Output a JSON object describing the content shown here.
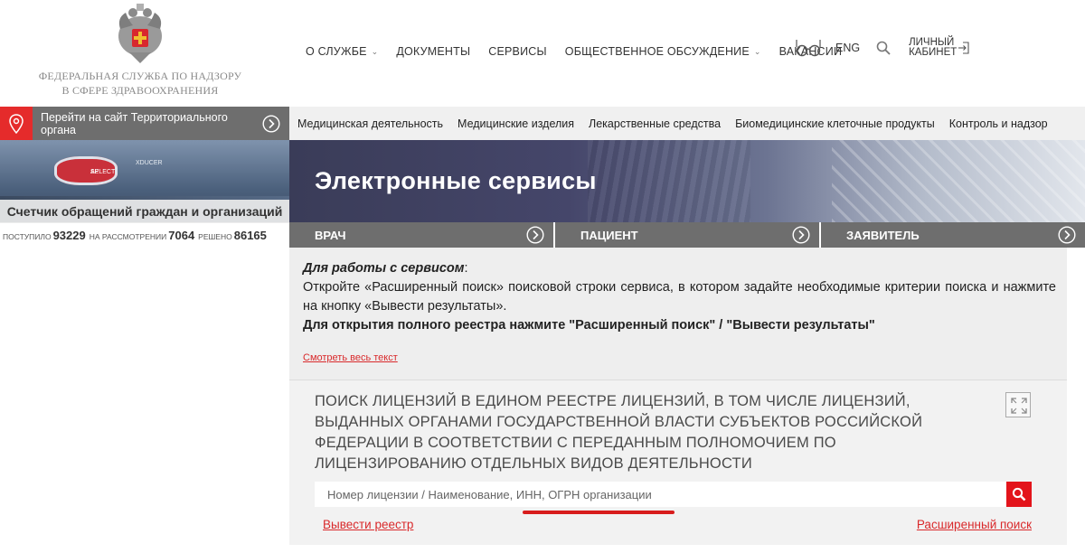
{
  "header": {
    "org_name_line1": "ФЕДЕРАЛЬНАЯ СЛУЖБА ПО НАДЗОРУ",
    "org_name_line2": "В СФЕРЕ ЗДРАВООХРАНЕНИЯ",
    "nav": [
      {
        "label": "О СЛУЖБЕ",
        "has_dropdown": true
      },
      {
        "label": "ДОКУМЕНТЫ",
        "has_dropdown": false
      },
      {
        "label": "СЕРВИСЫ",
        "has_dropdown": false
      },
      {
        "label": "ОБЩЕСТВЕННОЕ ОБСУЖДЕНИЕ",
        "has_dropdown": true
      },
      {
        "label": "ВАКАНСИИ",
        "has_dropdown": false
      }
    ],
    "accessibility_icon": "glasses-icon",
    "lang_label": "ENG",
    "search_icon": "search-icon",
    "cabinet_line1": "ЛИЧНЫЙ",
    "cabinet_line2": "КАБИНЕТ"
  },
  "territorial": {
    "label": "Перейти на сайт Территориального органа"
  },
  "categories": [
    "Медицинская деятельность",
    "Медицинские изделия",
    "Лекарственные средства",
    "Биомедицинские клеточные продукты",
    "Контроль и надзор"
  ],
  "banner": {
    "title": "Электронные сервисы",
    "device_label_1": "AP",
    "device_label_2": "SELECT",
    "device_label_3": "XDUCER"
  },
  "counter": {
    "title": "Счетчик обращений граждан и организаций",
    "received_label": "ПОСТУПИЛО",
    "received_value": "93229",
    "review_label": "НА РАССМОТРЕНИИ",
    "review_value": "7064",
    "resolved_label": "РЕШЕНО",
    "resolved_value": "86165"
  },
  "roles": [
    {
      "label": "ВРАЧ"
    },
    {
      "label": "ПАЦИЕНТ"
    },
    {
      "label": "ЗАЯВИТЕЛЬ"
    }
  ],
  "info": {
    "lead": "Для работы с сервисом",
    "lead_colon": ":",
    "text": "Откройте «Расширенный поиск» поисковой строки сервиса, в котором задайте необходимые критерии поиска и нажмите на кнопку «Вывести результаты».",
    "bold_text": "Для открытия полного реестра нажмите \"Расширенный поиск\" / \"Вывести результаты\"",
    "more_link": "Смотреть весь текст"
  },
  "search": {
    "title": "ПОИСК ЛИЦЕНЗИЙ В ЕДИНОМ РЕЕСТРЕ ЛИЦЕНЗИЙ, В ТОМ ЧИСЛЕ ЛИЦЕНЗИЙ, ВЫДАННЫХ ОРГАНАМИ ГОСУДАРСТВЕННОЙ ВЛАСТИ СУБЪЕКТОВ РОССИЙСКОЙ ФЕДЕРАЦИИ В СООТВЕТСТВИИ С ПЕРЕДАННЫМ ПОЛНОМОЧИЕМ ПО ЛИЦЕНЗИРОВАНИЮ ОТДЕЛЬНЫХ ВИДОВ ДЕЯТЕЛЬНОСТИ",
    "placeholder": "Номер лицензии / Наименование, ИНН, ОГРН организации",
    "value": "",
    "link_registry": "Вывести реестр",
    "link_advanced": "Расширенный поиск"
  },
  "colors": {
    "accent_red": "#e3141b",
    "bar_gray": "#6e6e6e",
    "info_bg": "#eeeeee"
  }
}
